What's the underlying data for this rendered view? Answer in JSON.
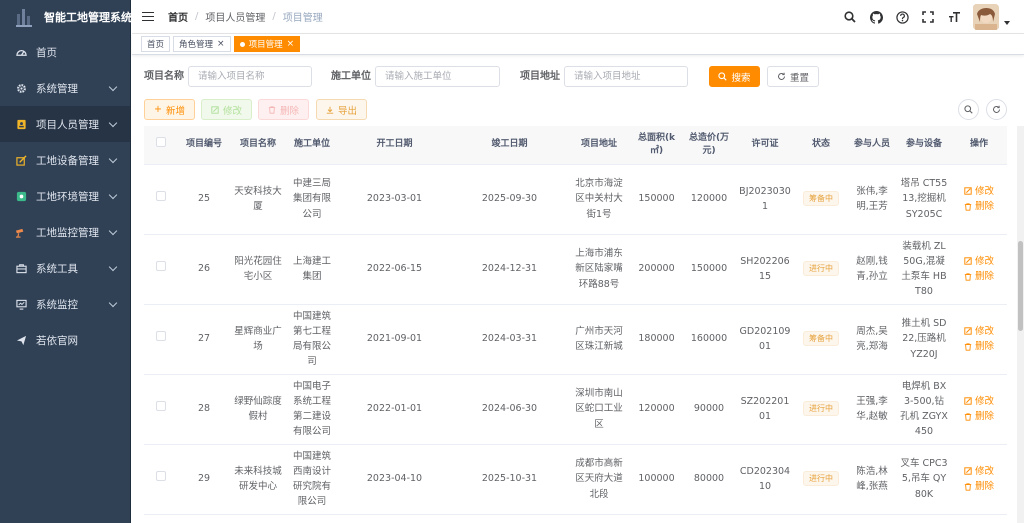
{
  "app": {
    "title": "智能工地管理系统"
  },
  "sidebar": {
    "items": [
      {
        "label": "首页",
        "icon": "dashboard-icon",
        "has_children": false
      },
      {
        "label": "系统管理",
        "icon": "gear-icon",
        "has_children": true
      },
      {
        "label": "项目人员管理",
        "icon": "user-card-icon",
        "has_children": true
      },
      {
        "label": "工地设备管理",
        "icon": "edit-box-icon",
        "has_children": true
      },
      {
        "label": "工地环境管理",
        "icon": "environment-icon",
        "has_children": true
      },
      {
        "label": "工地监控管理",
        "icon": "monitor-camera-icon",
        "has_children": true
      },
      {
        "label": "系统工具",
        "icon": "toolbox-icon",
        "has_children": true
      },
      {
        "label": "系统监控",
        "icon": "screen-icon",
        "has_children": true
      },
      {
        "label": "若依官网",
        "icon": "send-icon",
        "has_children": false
      }
    ]
  },
  "breadcrumb": {
    "items": [
      "首页",
      "项目人员管理",
      "项目管理"
    ]
  },
  "tags": {
    "items": [
      {
        "label": "首页"
      },
      {
        "label": "角色管理"
      },
      {
        "label": "项目管理"
      }
    ]
  },
  "search": {
    "name_label": "项目名称",
    "name_placeholder": "请输入项目名称",
    "unit_label": "施工单位",
    "unit_placeholder": "请输入施工单位",
    "addr_label": "项目地址",
    "addr_placeholder": "请输入项目地址",
    "search_btn": "搜索",
    "reset_btn": "重置"
  },
  "toolbar": {
    "add": "新增",
    "edit": "修改",
    "delete": "删除",
    "export": "导出"
  },
  "table": {
    "headers": [
      "项目编号",
      "项目名称",
      "施工单位",
      "开工日期",
      "竣工日期",
      "项目地址",
      "总面积(k㎡)",
      "总造价(万元)",
      "许可证",
      "状态",
      "参与人员",
      "参与设备",
      "操作"
    ],
    "rows": [
      {
        "id": "25",
        "name": "天安科技大厦",
        "unit": "中建三局集团有限公司",
        "start": "2023-03-01",
        "end": "2025-09-30",
        "address": "北京市海淀区中关村大街1号",
        "area": "150000",
        "cost": "120000",
        "license": "BJ20230301",
        "status": "筹备中",
        "staff": "张伟,李明,王芳",
        "equipment": "塔吊 CT5513,挖掘机 SY205C"
      },
      {
        "id": "26",
        "name": "阳光花园住宅小区",
        "unit": "上海建工集团",
        "start": "2022-06-15",
        "end": "2024-12-31",
        "address": "上海市浦东新区陆家嘴环路88号",
        "area": "200000",
        "cost": "150000",
        "license": "SH20220615",
        "status": "进行中",
        "staff": "赵刚,钱青,孙立",
        "equipment": "装载机 ZL50G,混凝土泵车 HBT80"
      },
      {
        "id": "27",
        "name": "星辉商业广场",
        "unit": "中国建筑第七工程局有限公司",
        "start": "2021-09-01",
        "end": "2024-03-31",
        "address": "广州市天河区珠江新城",
        "area": "180000",
        "cost": "160000",
        "license": "GD20210901",
        "status": "筹备中",
        "staff": "周杰,吴亮,郑海",
        "equipment": "推土机 SD22,压路机 YZ20J"
      },
      {
        "id": "28",
        "name": "绿野仙踪度假村",
        "unit": "中国电子系统工程第二建设有限公司",
        "start": "2022-01-01",
        "end": "2024-06-30",
        "address": "深圳市南山区蛇口工业区",
        "area": "120000",
        "cost": "90000",
        "license": "SZ20220101",
        "status": "进行中",
        "staff": "王强,李华,赵敏",
        "equipment": "电焊机 BX3-500,钻孔机 ZGYX450"
      },
      {
        "id": "29",
        "name": "未来科技城研发中心",
        "unit": "中国建筑西南设计研究院有限公司",
        "start": "2023-04-10",
        "end": "2025-10-31",
        "address": "成都市高新区天府大道北段",
        "area": "100000",
        "cost": "80000",
        "license": "CD20230410",
        "status": "进行中",
        "staff": "陈浩,林峰,张燕",
        "equipment": "叉车 CPC35,吊车 QY80K"
      }
    ],
    "op_edit": "修改",
    "op_delete": "删除"
  },
  "colors": {
    "sidebar_bg": "#304156",
    "accent": "#ff8c00",
    "status_text": "#e6a23c"
  }
}
